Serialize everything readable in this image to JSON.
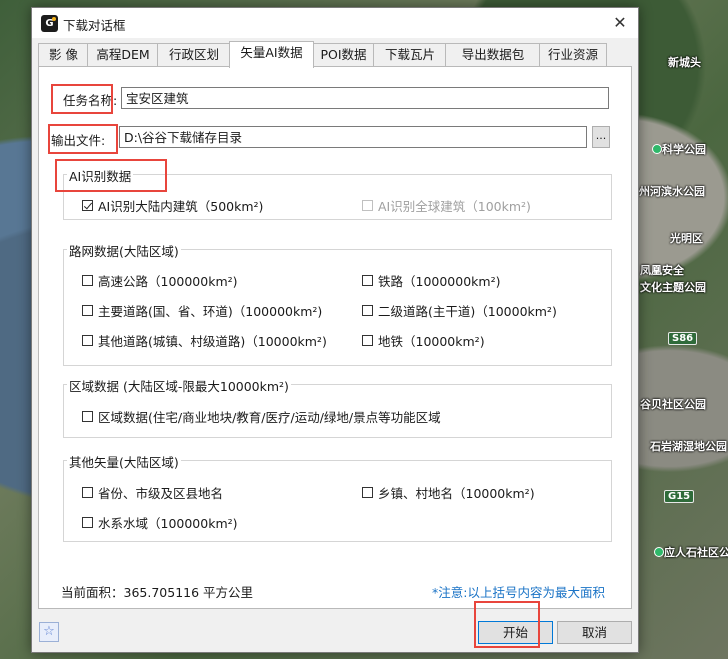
{
  "map": {
    "labels": [
      "新城头",
      "科学公园",
      "州河滨水公园",
      "光明区",
      "凤凰安全",
      "文化主题公园",
      "谷贝社区公园",
      "石岩湖湿地公园",
      "应人石社区公"
    ],
    "roads": [
      "S86",
      "G15"
    ]
  },
  "window": {
    "title": "下载对话框",
    "icon": "app-logo-icon",
    "close": "✕"
  },
  "tabs": [
    "影 像",
    "高程DEM",
    "行政区划",
    "矢量AI数据",
    "POI数据",
    "下载瓦片",
    "导出数据包",
    "行业资源"
  ],
  "active_tab": "矢量AI数据",
  "task": {
    "label": "任务名称:",
    "value": "宝安区建筑"
  },
  "output": {
    "label": "输出文件:",
    "value": "D:\\谷谷下载储存目录",
    "browse": "..."
  },
  "ai_group": {
    "title": "AI识别数据",
    "items": [
      {
        "label": "AI识别大陆内建筑（500km²)",
        "checked": true,
        "disabled": false
      },
      {
        "label": "AI识别全球建筑（100km²)",
        "checked": false,
        "disabled": true
      }
    ]
  },
  "road_group": {
    "title": "路网数据(大陆区域)",
    "items": [
      {
        "label": "高速公路（100000km²)"
      },
      {
        "label": "铁路（1000000km²)"
      },
      {
        "label": "主要道路(国、省、环道)（100000km²)"
      },
      {
        "label": "二级道路(主干道)（10000km²)"
      },
      {
        "label": "其他道路(城镇、村级道路)（10000km²)"
      },
      {
        "label": "地铁（10000km²)"
      }
    ]
  },
  "region_group": {
    "title": "区域数据 (大陆区域-限最大10000km²)",
    "items": [
      {
        "label": "区域数据(住宅/商业地块/教育/医疗/运动/绿地/景点等功能区域"
      }
    ]
  },
  "other_group": {
    "title": "其他矢量(大陆区域)",
    "items": [
      {
        "label": "省份、市级及区县地名"
      },
      {
        "label": "乡镇、村地名（10000km²)"
      },
      {
        "label": "水系水域（100000km²)"
      }
    ]
  },
  "area": {
    "text": "当前面积：365.705116 平方公里"
  },
  "note": {
    "text": "*注意:以上括号内容为最大面积"
  },
  "buttons": {
    "start": "开始",
    "cancel": "取消",
    "favorite": "☆"
  },
  "colors": {
    "highlight": "#e8453c",
    "note": "#1a73c6",
    "accent": "#0078d7"
  }
}
